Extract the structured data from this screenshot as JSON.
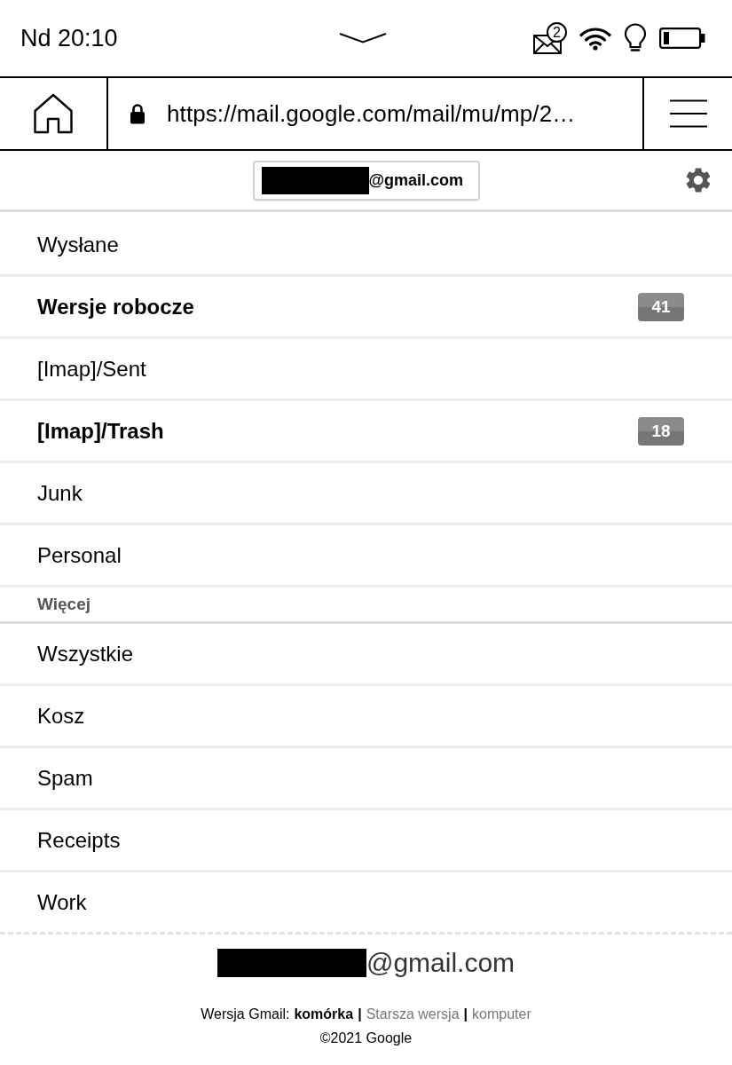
{
  "status_bar": {
    "time": "Nd 20:10",
    "mail_badge": "2"
  },
  "browser": {
    "url": "https://mail.google.com/mail/mu/mp/2…"
  },
  "account": {
    "email": "@gmail.com"
  },
  "folders": [
    {
      "label": "Wysłane",
      "unread": false
    },
    {
      "label": "Wersje robocze",
      "unread": true,
      "count": "41"
    },
    {
      "label": "[Imap]/Sent",
      "unread": false
    },
    {
      "label": "[Imap]/Trash",
      "unread": true,
      "count": "18"
    },
    {
      "label": "Junk",
      "unread": false
    },
    {
      "label": "Personal",
      "unread": false
    }
  ],
  "more": {
    "title": "Więcej",
    "folders": [
      {
        "label": "Wszystkie",
        "unread": false
      },
      {
        "label": "Kosz",
        "unread": false
      },
      {
        "label": "Spam",
        "unread": false
      },
      {
        "label": "Receipts",
        "unread": false
      },
      {
        "label": "Work",
        "unread": false
      }
    ]
  },
  "footer": {
    "email": "@gmail.com",
    "version_label": "Wersja Gmail:",
    "versions": [
      {
        "label": "komórka",
        "selected": true
      },
      {
        "label": "Starsza wersja",
        "selected": false
      },
      {
        "label": "komputer",
        "selected": false
      }
    ],
    "separators": [
      "|",
      "|"
    ],
    "copyright": "©2021 Google"
  }
}
